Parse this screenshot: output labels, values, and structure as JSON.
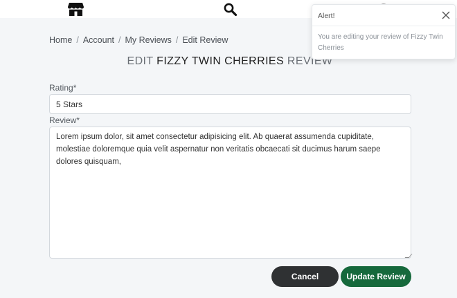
{
  "nav": {
    "icons": [
      "store-icon",
      "search-icon",
      "cart-icon"
    ]
  },
  "breadcrumb": {
    "items": [
      "Home",
      "Account",
      "My Reviews",
      "Edit Review"
    ],
    "separator": "/"
  },
  "page": {
    "title_prefix": "EDIT",
    "product_name": "FIZZY TWIN CHERRIES",
    "title_suffix": "REVIEW"
  },
  "form": {
    "rating_label": "Rating*",
    "rating_value": "5 Stars",
    "review_label": "Review*",
    "review_value": "Lorem ipsum dolor, sit amet consectetur adipisicing elit. Ab quaerat assumenda cupiditate, molestiae doloremque quia velit aspernatur non veritatis obcaecati sit ducimus harum saepe dolores quisquam,",
    "cancel_label": "Cancel",
    "submit_label": "Update Review"
  },
  "alert": {
    "title": "Alert!",
    "message": "You are editing your review of Fizzy Twin Cherries"
  },
  "colors": {
    "background": "#f4f6f8",
    "cancel_button": "#2f3133",
    "submit_button": "#16693c"
  }
}
